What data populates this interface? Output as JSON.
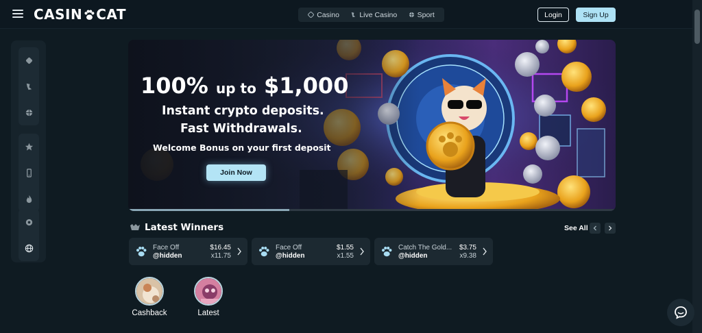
{
  "header": {
    "logo_left": "CASIN",
    "logo_right": "CAT",
    "nav": [
      {
        "label": "Casino",
        "icon": "casino-icon"
      },
      {
        "label": "Live Casino",
        "icon": "live-casino-icon"
      },
      {
        "label": "Sport",
        "icon": "sport-icon"
      }
    ],
    "login_label": "Login",
    "signup_label": "Sign Up"
  },
  "sidebar": {
    "items": [
      {
        "icon": "casino-icon"
      },
      {
        "icon": "live-casino-icon"
      },
      {
        "icon": "sport-icon"
      },
      {
        "icon": "star-icon"
      },
      {
        "icon": "mobile-icon"
      },
      {
        "icon": "flame-icon"
      },
      {
        "icon": "support-icon"
      },
      {
        "icon": "globe-icon"
      }
    ]
  },
  "banner": {
    "headline_percent": "100%",
    "headline_upto": "up to",
    "headline_amount": "$1,000",
    "line1": "Instant crypto deposits.",
    "line2": "Fast Withdrawals.",
    "line3": "Welcome Bonus on your first deposit",
    "cta": "Join Now",
    "progress": 0.33
  },
  "winners": {
    "title": "Latest Winners",
    "see_all": "See All",
    "items": [
      {
        "game": "Face Off",
        "user": "@hidden",
        "amount": "$16.45",
        "multiplier": "x11.75"
      },
      {
        "game": "Face Off",
        "user": "@hidden",
        "amount": "$1.55",
        "multiplier": "x1.55"
      },
      {
        "game": "Catch The Gold...",
        "user": "@hidden",
        "amount": "$3.75",
        "multiplier": "x9.38"
      }
    ]
  },
  "categories": [
    {
      "label": "Cashback"
    },
    {
      "label": "Latest"
    }
  ],
  "colors": {
    "background": "#0f1b22",
    "accent": "#aee2f5",
    "card": "#1c2931"
  }
}
